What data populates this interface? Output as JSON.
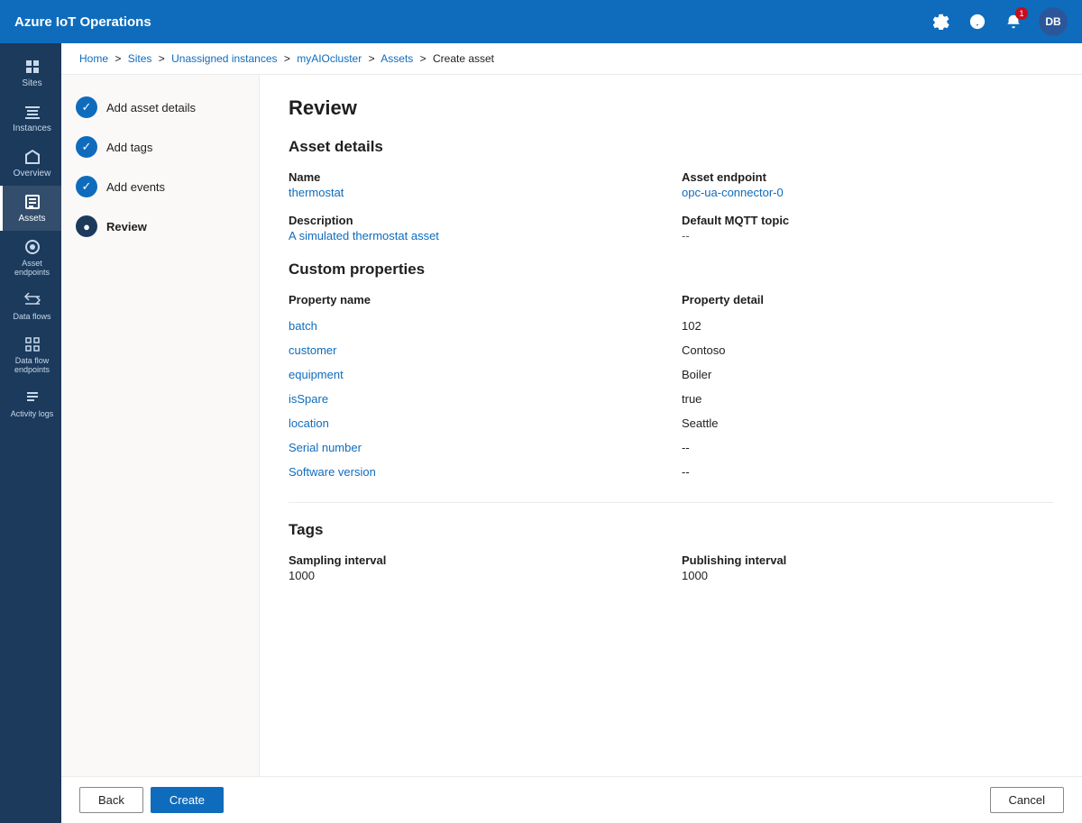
{
  "app": {
    "title": "Azure IoT Operations"
  },
  "topnav": {
    "icons": {
      "settings": "⚙",
      "help": "?",
      "bell": "🔔",
      "notification_count": "1",
      "avatar_initials": "DB"
    }
  },
  "breadcrumb": {
    "items": [
      "Home",
      "Sites",
      "Unassigned instances",
      "myAIOcluster",
      "Assets",
      "Create asset"
    ]
  },
  "sidebar": {
    "items": [
      {
        "id": "sites",
        "label": "Sites",
        "active": false
      },
      {
        "id": "instances",
        "label": "Instances",
        "active": false
      },
      {
        "id": "overview",
        "label": "Overview",
        "active": false
      },
      {
        "id": "assets",
        "label": "Assets",
        "active": true
      },
      {
        "id": "asset-endpoints",
        "label": "Asset endpoints",
        "active": false
      },
      {
        "id": "data-flows",
        "label": "Data flows",
        "active": false
      },
      {
        "id": "data-flow-endpoints",
        "label": "Data flow endpoints",
        "active": false
      },
      {
        "id": "activity-logs",
        "label": "Activity logs",
        "active": false
      }
    ]
  },
  "stepper": {
    "steps": [
      {
        "id": "add-asset-details",
        "label": "Add asset details",
        "state": "completed"
      },
      {
        "id": "add-tags",
        "label": "Add tags",
        "state": "completed"
      },
      {
        "id": "add-events",
        "label": "Add events",
        "state": "completed"
      },
      {
        "id": "review",
        "label": "Review",
        "state": "active"
      }
    ]
  },
  "review": {
    "title": "Review",
    "asset_details": {
      "section_title": "Asset details",
      "name_label": "Name",
      "name_value": "thermostat",
      "asset_endpoint_label": "Asset endpoint",
      "asset_endpoint_value": "opc-ua-connector-0",
      "description_label": "Description",
      "description_value": "A simulated thermostat asset",
      "mqtt_topic_label": "Default MQTT topic",
      "mqtt_topic_value": "--"
    },
    "custom_properties": {
      "section_title": "Custom properties",
      "property_name_header": "Property name",
      "property_detail_header": "Property detail",
      "rows": [
        {
          "name": "batch",
          "detail": "102"
        },
        {
          "name": "customer",
          "detail": "Contoso"
        },
        {
          "name": "equipment",
          "detail": "Boiler"
        },
        {
          "name": "isSpare",
          "detail": "true"
        },
        {
          "name": "location",
          "detail": "Seattle"
        },
        {
          "name": "Serial number",
          "detail": "--"
        },
        {
          "name": "Software version",
          "detail": "--"
        }
      ]
    },
    "tags": {
      "section_title": "Tags",
      "sampling_interval_label": "Sampling interval",
      "sampling_interval_value": "1000",
      "publishing_interval_label": "Publishing interval",
      "publishing_interval_value": "1000"
    }
  },
  "actions": {
    "back_label": "Back",
    "create_label": "Create",
    "cancel_label": "Cancel"
  }
}
